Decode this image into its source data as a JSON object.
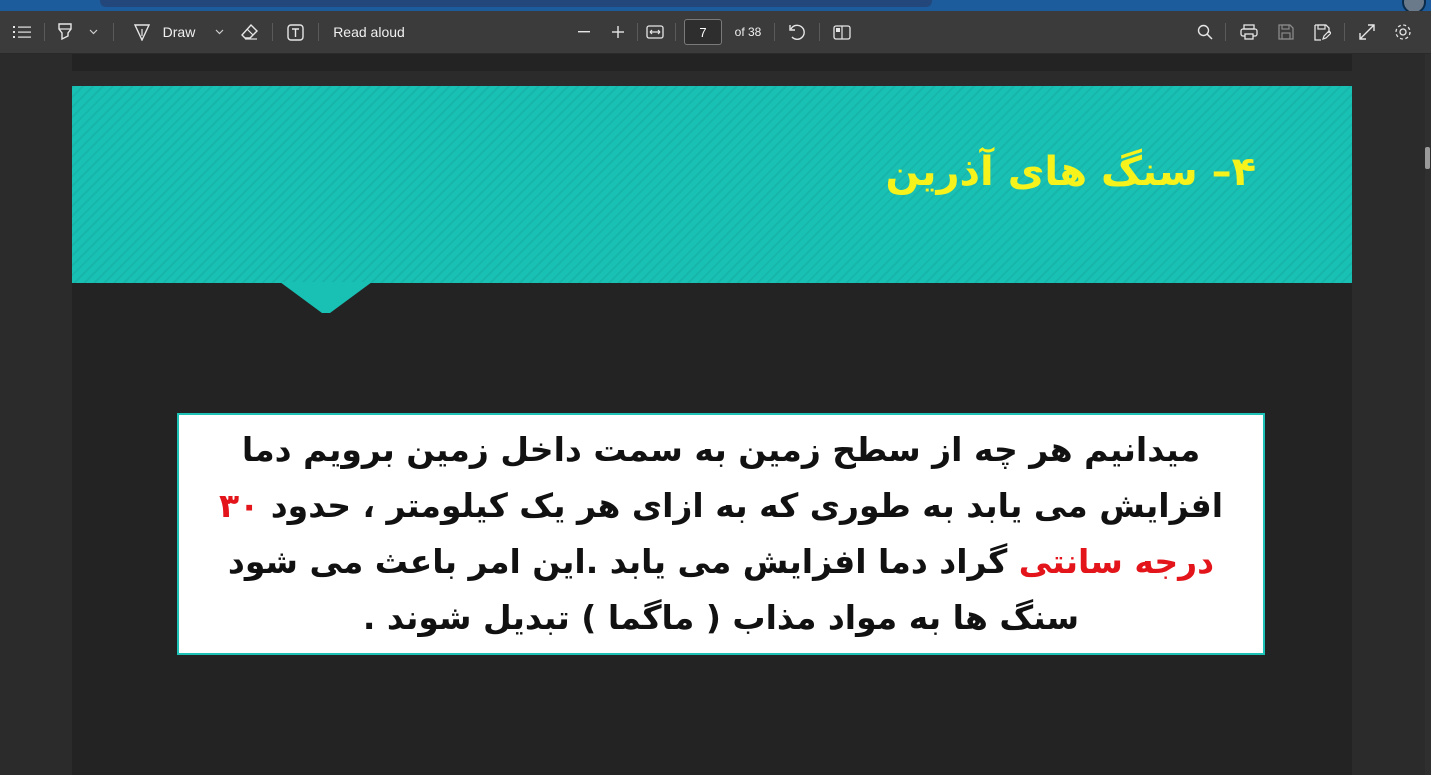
{
  "toolbar": {
    "draw_label": "Draw",
    "read_aloud_label": "Read aloud",
    "page_current": "7",
    "page_total": "of 38"
  },
  "slide": {
    "heading": "۴– سنگ های آذرین",
    "body_before": "میدانیم هر چه از سطح زمین به سمت داخل زمین برویم دما افزایش می یابد به طوری که به ازای هر یک کیلومتر ، حدود",
    "body_highlight": "۳۰ درجه سانتی",
    "body_after": "گراد دما افزایش می یابد .این امر باعث می شود سنگ ها به مواد مذاب ( ماگما ) تبدیل شوند ."
  },
  "colors": {
    "banner": "#19c1b5",
    "heading": "#f6f21b",
    "highlight": "#e3151b",
    "slide_bg": "#232323",
    "toolbar_bg": "#3b3b3b"
  }
}
